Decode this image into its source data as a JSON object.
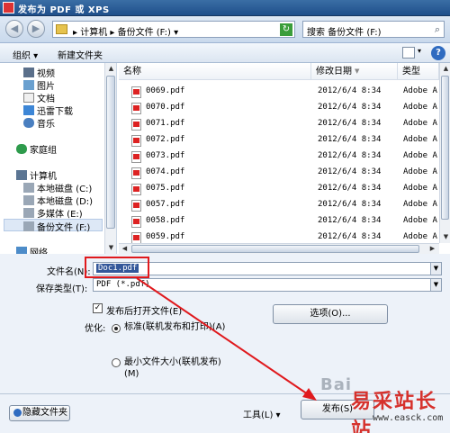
{
  "window": {
    "title": "发布为 PDF 或 XPS"
  },
  "address": {
    "path": "▸ 计算机 ▸ 备份文件 (F:) ▾",
    "search_placeholder": "搜索 备份文件 (F:)"
  },
  "toolbar": {
    "organize": "组织 ▾",
    "new_folder": "新建文件夹",
    "help": "?"
  },
  "nav": {
    "items": [
      {
        "label": "视频",
        "icon": "video-icon"
      },
      {
        "label": "图片",
        "icon": "picture-icon"
      },
      {
        "label": "文档",
        "icon": "document-icon"
      },
      {
        "label": "迅雷下载",
        "icon": "download-icon"
      },
      {
        "label": "音乐",
        "icon": "music-icon"
      },
      {
        "label": "家庭组",
        "icon": "homegroup-icon"
      },
      {
        "label": "计算机",
        "icon": "computer-icon"
      },
      {
        "label": "本地磁盘 (C:)",
        "icon": "drive-icon"
      },
      {
        "label": "本地磁盘 (D:)",
        "icon": "drive-icon"
      },
      {
        "label": "多媒体 (E:)",
        "icon": "drive-icon"
      },
      {
        "label": "备份文件 (F:)",
        "icon": "drive-icon"
      },
      {
        "label": "网络",
        "icon": "network-icon"
      }
    ]
  },
  "files": {
    "columns": [
      "名称",
      "修改日期",
      "类型"
    ],
    "rows": [
      {
        "name": "0069.pdf",
        "date": "2012/6/4 8:34",
        "type": "Adobe A"
      },
      {
        "name": "0070.pdf",
        "date": "2012/6/4 8:34",
        "type": "Adobe A"
      },
      {
        "name": "0071.pdf",
        "date": "2012/6/4 8:34",
        "type": "Adobe A"
      },
      {
        "name": "0072.pdf",
        "date": "2012/6/4 8:34",
        "type": "Adobe A"
      },
      {
        "name": "0073.pdf",
        "date": "2012/6/4 8:34",
        "type": "Adobe A"
      },
      {
        "name": "0074.pdf",
        "date": "2012/6/4 8:34",
        "type": "Adobe A"
      },
      {
        "name": "0075.pdf",
        "date": "2012/6/4 8:34",
        "type": "Adobe A"
      },
      {
        "name": "0057.pdf",
        "date": "2012/6/4 8:34",
        "type": "Adobe A"
      },
      {
        "name": "0058.pdf",
        "date": "2012/6/4 8:34",
        "type": "Adobe A"
      },
      {
        "name": "0059.pdf",
        "date": "2012/6/4 8:34",
        "type": "Adobe A"
      }
    ]
  },
  "form": {
    "filename_label": "文件名(N):",
    "filename_value": "Doc1.pdf",
    "filetype_label": "保存类型(T):",
    "filetype_value": "PDF (*.pdf)",
    "open_after_publish": "发布后打开文件(E)",
    "optimize_label": "优化:",
    "opt_standard": "标准(联机发布和打印)(A)",
    "opt_minimum": "最小文件大小(联机发布)(M)",
    "options_button": "选项(O)...",
    "hide_folders": "隐藏文件夹",
    "tools": "工具(L) ▾",
    "publish": "发布(S)"
  },
  "watermark": {
    "baidu": "Bai",
    "site_cn": "易采站长站",
    "site_url": "www.easck.com"
  },
  "colors": {
    "annotation": "#e0191d",
    "titlebar": "#1f4f8b"
  }
}
